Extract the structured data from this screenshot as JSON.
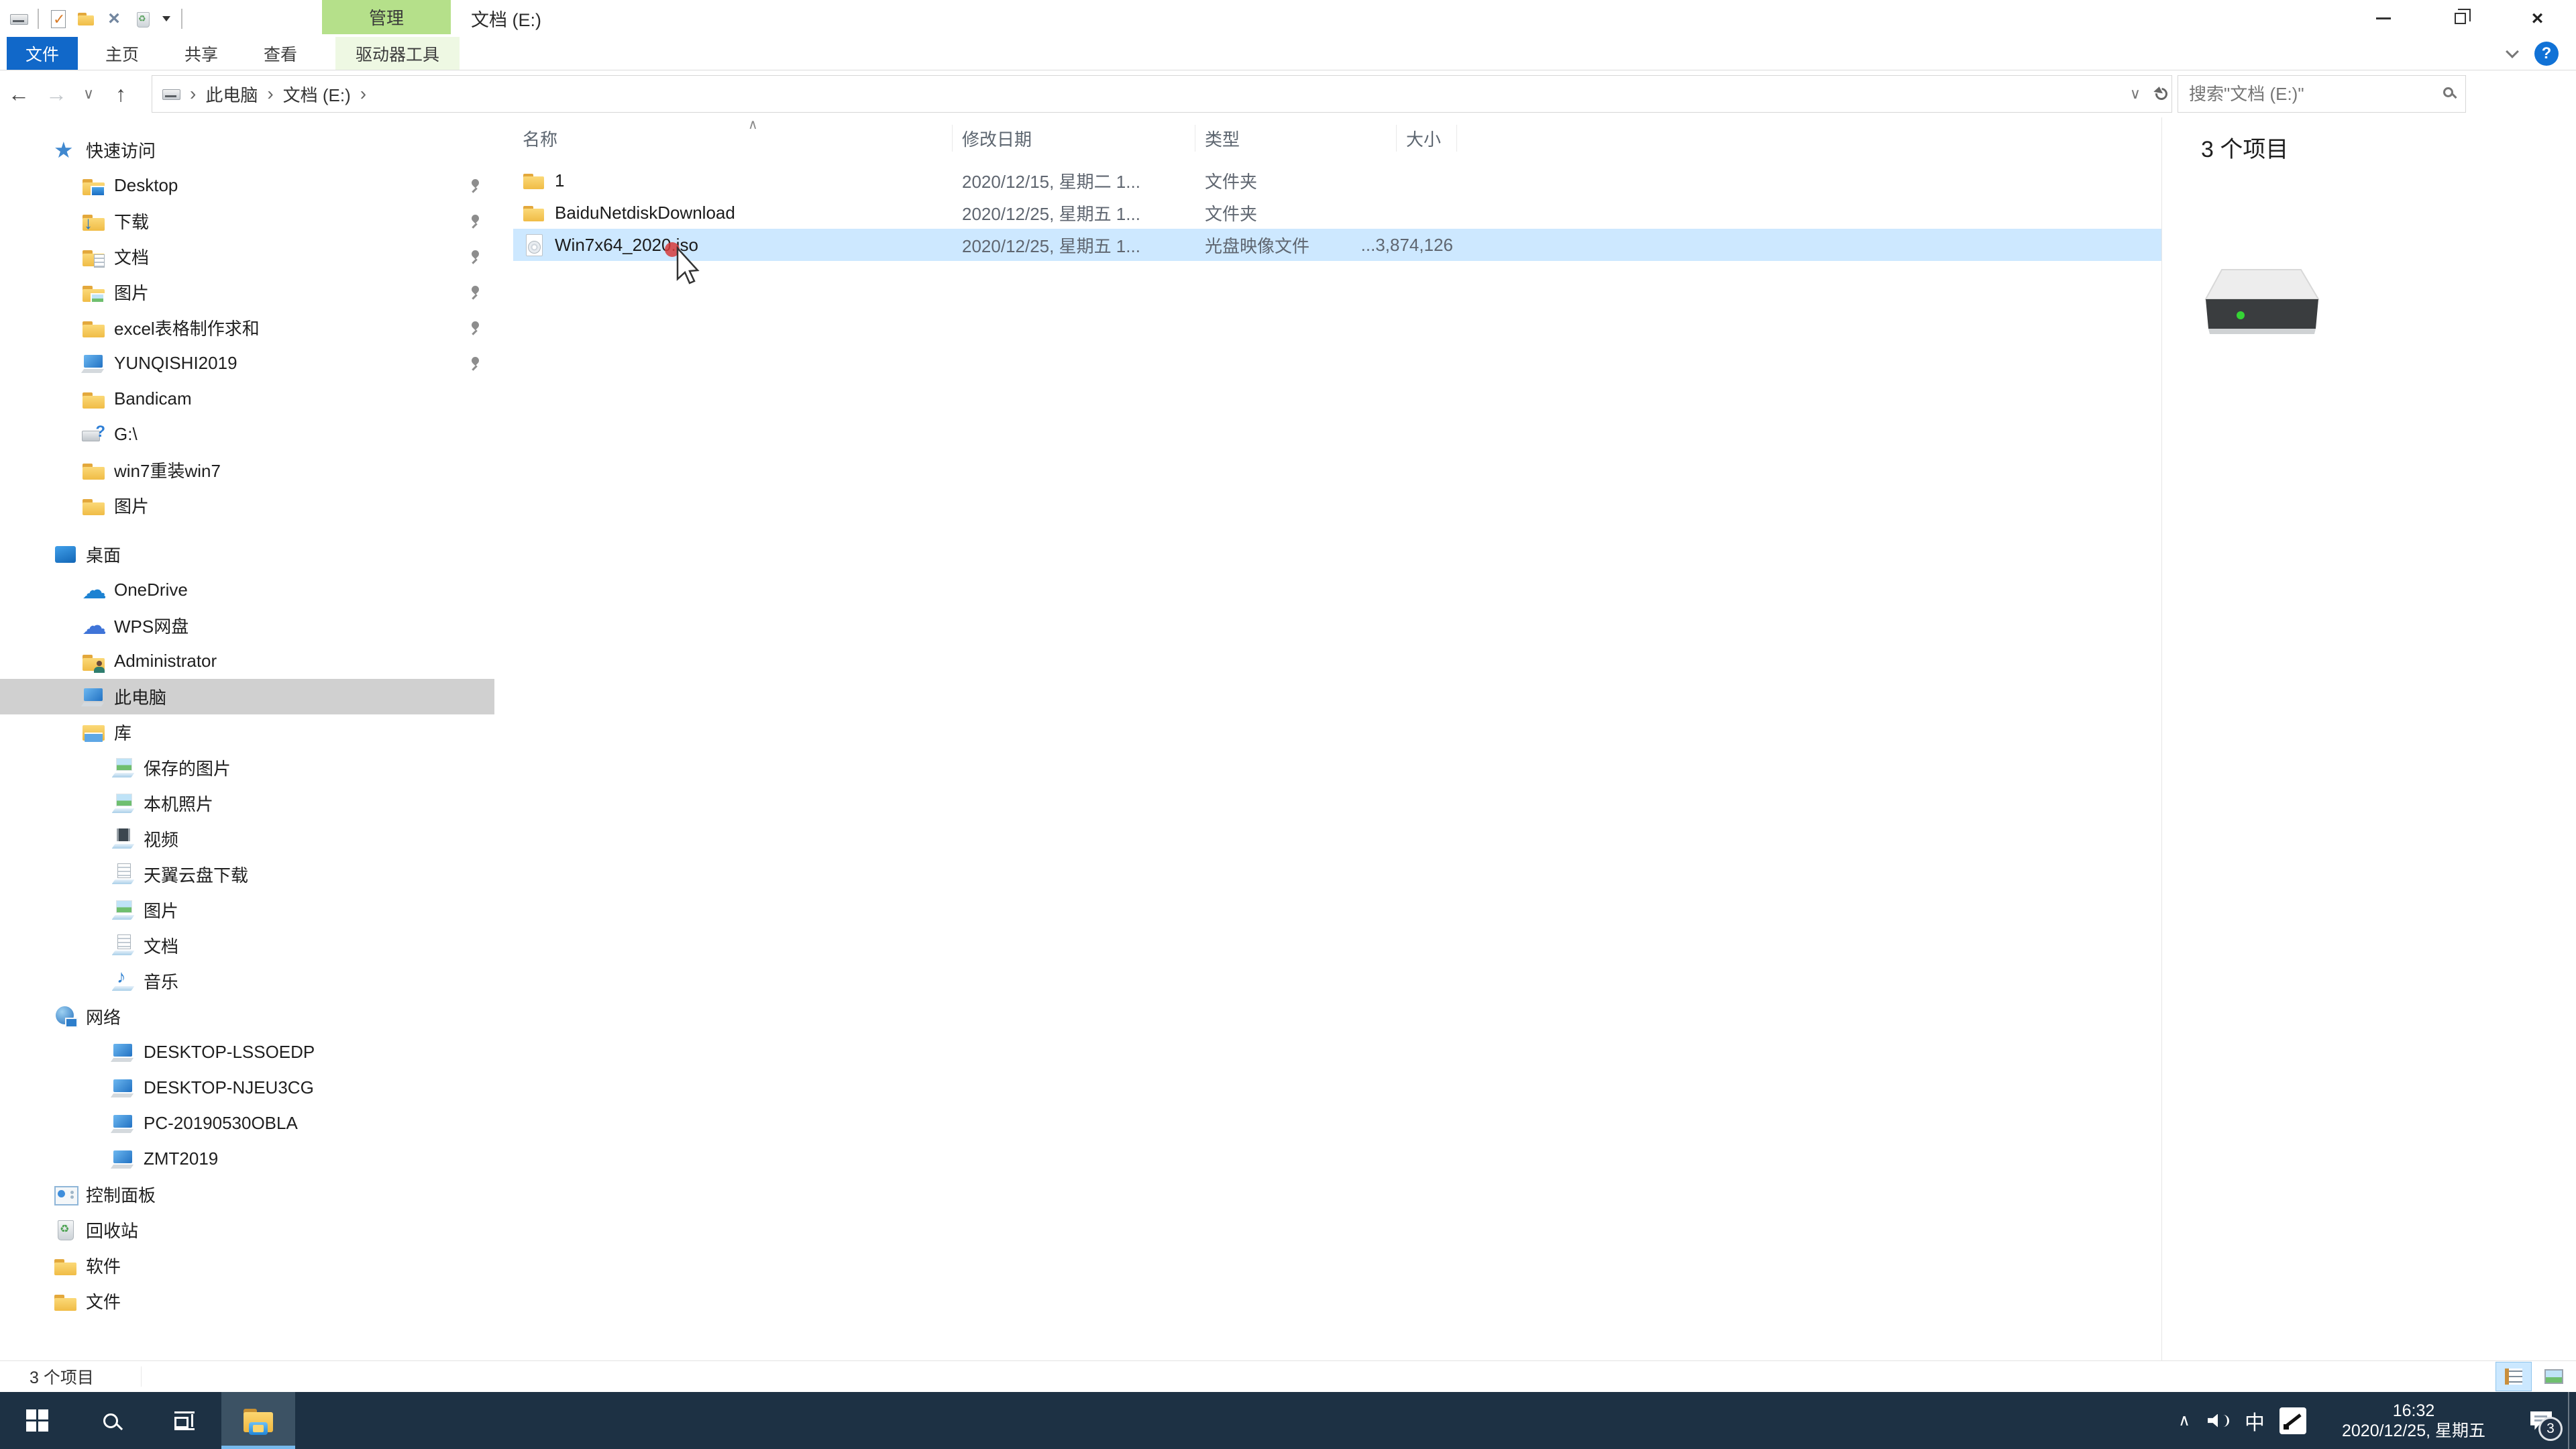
{
  "titlebar": {
    "window_title": "文档 (E:)",
    "contextual_tab_label": "管理",
    "quick_access_icons": [
      "drive-icon",
      "separator",
      "checkmark-document-icon",
      "new-folder-icon",
      "delete-icon",
      "recycle-bin-icon",
      "dropdown-icon",
      "separator"
    ]
  },
  "ribbon": {
    "file_tab": "文件",
    "tabs": [
      "主页",
      "共享",
      "查看"
    ],
    "contextual_tab": "驱动器工具",
    "help_label": "?"
  },
  "address_bar": {
    "breadcrumb_root_icon": "drive-icon",
    "breadcrumb": [
      "此电脑",
      "文档 (E:)"
    ],
    "search_placeholder": "搜索\"文档 (E:)\""
  },
  "sidebar": {
    "items": [
      {
        "label": "快速访问",
        "icon": "star",
        "level": 0
      },
      {
        "label": "Desktop",
        "icon": "folder-desktop",
        "level": 1,
        "pinned": true
      },
      {
        "label": "下载",
        "icon": "folder-download",
        "level": 1,
        "pinned": true
      },
      {
        "label": "文档",
        "icon": "folder-doc",
        "level": 1,
        "pinned": true
      },
      {
        "label": "图片",
        "icon": "folder-pic",
        "level": 1,
        "pinned": true
      },
      {
        "label": "excel表格制作求和",
        "icon": "folder",
        "level": 1,
        "pinned": true
      },
      {
        "label": "YUNQISHI2019",
        "icon": "pc",
        "level": 1,
        "pinned": true
      },
      {
        "label": "Bandicam",
        "icon": "folder",
        "level": 1
      },
      {
        "label": "G:\\",
        "icon": "usb",
        "level": 1
      },
      {
        "label": "win7重装win7",
        "icon": "folder",
        "level": 1
      },
      {
        "label": "图片",
        "icon": "folder",
        "level": 1
      },
      {
        "label": "桌面",
        "icon": "desktop",
        "level": 0,
        "group_gap": true
      },
      {
        "label": "OneDrive",
        "icon": "cloud",
        "level": 1
      },
      {
        "label": "WPS网盘",
        "icon": "cloud2",
        "level": 1
      },
      {
        "label": "Administrator",
        "icon": "folder-user",
        "level": 1
      },
      {
        "label": "此电脑",
        "icon": "pc",
        "level": 1,
        "selected": true
      },
      {
        "label": "库",
        "icon": "library",
        "level": 1
      },
      {
        "label": "保存的图片",
        "icon": "lib-pic",
        "level": 2
      },
      {
        "label": "本机照片",
        "icon": "lib-pic",
        "level": 2
      },
      {
        "label": "视频",
        "icon": "lib-video",
        "level": 2
      },
      {
        "label": "天翼云盘下载",
        "icon": "lib-doc",
        "level": 2
      },
      {
        "label": "图片",
        "icon": "lib-pic",
        "level": 2
      },
      {
        "label": "文档",
        "icon": "lib-doc",
        "level": 2
      },
      {
        "label": "音乐",
        "icon": "lib-music",
        "level": 2
      },
      {
        "label": "网络",
        "icon": "network",
        "level": 0
      },
      {
        "label": "DESKTOP-LSSOEDP",
        "icon": "pc",
        "level": 2
      },
      {
        "label": "DESKTOP-NJEU3CG",
        "icon": "pc",
        "level": 2
      },
      {
        "label": "PC-20190530OBLA",
        "icon": "pc",
        "level": 2
      },
      {
        "label": "ZMT2019",
        "icon": "pc",
        "level": 2
      },
      {
        "label": "控制面板",
        "icon": "cpanel",
        "level": 0
      },
      {
        "label": "回收站",
        "icon": "recycle",
        "level": 0
      },
      {
        "label": "软件",
        "icon": "folder",
        "level": 0
      },
      {
        "label": "文件",
        "icon": "folder",
        "level": 0
      }
    ]
  },
  "file_list": {
    "columns": [
      "名称",
      "修改日期",
      "类型",
      "大小"
    ],
    "rows": [
      {
        "name": "1",
        "date": "2020/12/15, 星期二 1...",
        "type": "文件夹",
        "size": "",
        "icon": "folder",
        "selected": false
      },
      {
        "name": "BaiduNetdiskDownload",
        "date": "2020/12/25, 星期五 1...",
        "type": "文件夹",
        "size": "",
        "icon": "folder",
        "selected": false
      },
      {
        "name": "Win7x64_2020.iso",
        "date": "2020/12/25, 星期五 1...",
        "type": "光盘映像文件",
        "size": "3,874,126...",
        "icon": "iso",
        "selected": true
      }
    ]
  },
  "details_pane": {
    "item_count": "3 个项目"
  },
  "status_bar": {
    "item_count": "3 个项目"
  },
  "taskbar": {
    "ime_indicator": "中",
    "time": "16:32",
    "date": "2020/12/25, 星期五",
    "notification_badge": "3"
  },
  "colors": {
    "accent_blue": "#1168c9",
    "contextual_green": "#b5e08a",
    "selection_blue": "#cde8ff",
    "taskbar_dark": "#1d3144"
  }
}
